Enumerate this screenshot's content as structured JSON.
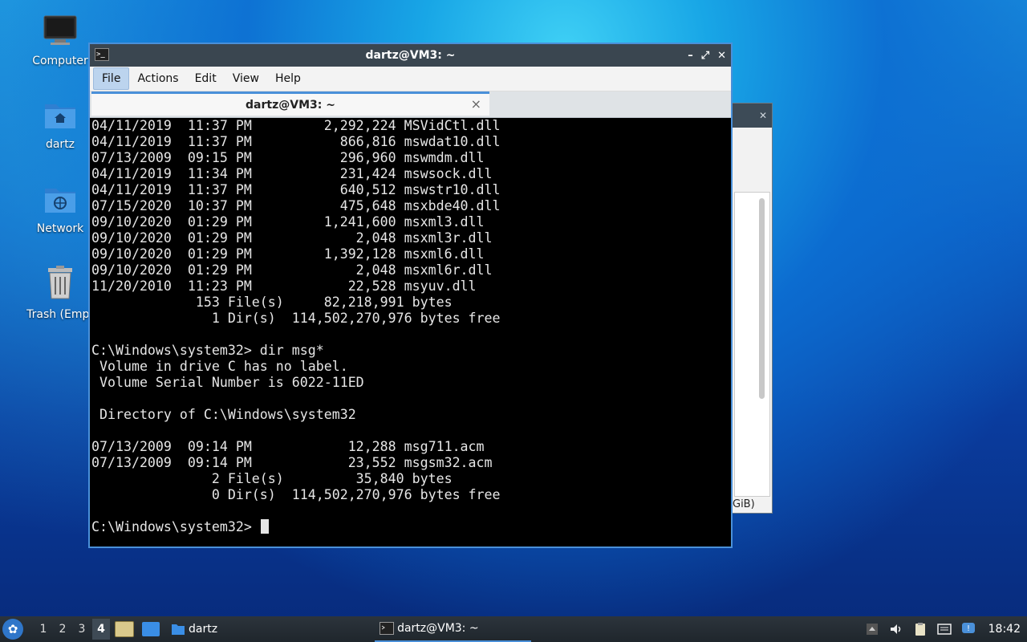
{
  "desktop": {
    "icons": [
      {
        "label": "Computer",
        "icon": "monitor-icon"
      },
      {
        "label": "dartz",
        "icon": "home-folder-icon"
      },
      {
        "label": "Network",
        "icon": "network-folder-icon"
      },
      {
        "label": "Trash (Empt",
        "icon": "trash-icon"
      }
    ]
  },
  "background_window": {
    "status_text": "GiB)"
  },
  "terminal": {
    "title": "dartz@VM3: ~",
    "controls": {
      "minimize": "–",
      "maximize": "⤢",
      "close": "✕"
    },
    "menu": [
      "File",
      "Actions",
      "Edit",
      "View",
      "Help"
    ],
    "tab": {
      "label": "dartz@VM3: ~",
      "close": "×"
    },
    "lines": [
      "04/11/2019  11:37 PM         2,292,224 MSVidCtl.dll",
      "04/11/2019  11:37 PM           866,816 mswdat10.dll",
      "07/13/2009  09:15 PM           296,960 mswmdm.dll",
      "04/11/2019  11:34 PM           231,424 mswsock.dll",
      "04/11/2019  11:37 PM           640,512 mswstr10.dll",
      "07/15/2020  10:37 PM           475,648 msxbde40.dll",
      "09/10/2020  01:29 PM         1,241,600 msxml3.dll",
      "09/10/2020  01:29 PM             2,048 msxml3r.dll",
      "09/10/2020  01:29 PM         1,392,128 msxml6.dll",
      "09/10/2020  01:29 PM             2,048 msxml6r.dll",
      "11/20/2010  11:23 PM            22,528 msyuv.dll",
      "             153 File(s)     82,218,991 bytes",
      "               1 Dir(s)  114,502,270,976 bytes free",
      "",
      "C:\\Windows\\system32> dir msg*",
      " Volume in drive C has no label.",
      " Volume Serial Number is 6022-11ED",
      "",
      " Directory of C:\\Windows\\system32",
      "",
      "07/13/2009  09:14 PM            12,288 msg711.acm",
      "07/13/2009  09:14 PM            23,552 msgsm32.acm",
      "               2 File(s)         35,840 bytes",
      "               0 Dir(s)  114,502,270,976 bytes free",
      ""
    ],
    "prompt": "C:\\Windows\\system32> "
  },
  "taskbar": {
    "workspaces": [
      "1",
      "2",
      "3",
      "4"
    ],
    "active_workspace": "4",
    "folder_task": "dartz",
    "terminal_task": "dartz@VM3: ~",
    "clock": "18:42"
  },
  "colors": {
    "accent": "#4a90d9",
    "titlebar": "#3a4650",
    "terminal_bg": "#000000",
    "terminal_fg": "#e6e6e6"
  }
}
